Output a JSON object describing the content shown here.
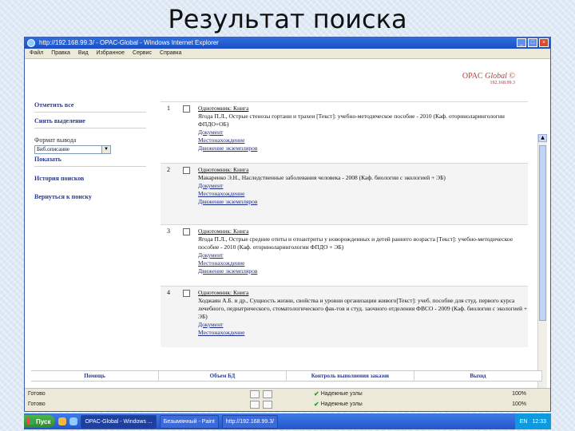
{
  "slide": {
    "title": "Результат поиска"
  },
  "window": {
    "title": "http://192.168.99.3/ - OPAC-Global - Windows Internet Explorer",
    "menu": [
      "Файл",
      "Правка",
      "Вид",
      "Избранное",
      "Сервис",
      "Справка"
    ]
  },
  "brand": {
    "name": "OPAC",
    "suffix": "Global",
    "ip": "192.168.99.3"
  },
  "sidebar": {
    "mark_all": "Отметить все",
    "unmark": "Снять выделение",
    "format_label": "Формат вывода",
    "format_value": "Биб.описание",
    "show": "Показать",
    "history": "История поисков",
    "back": "Вернуться к поиску"
  },
  "results": [
    {
      "num": "1",
      "type": "Однотомник: Книга",
      "desc": "Ягода П.Л., Острые стенозы гортани и трахеи [Текст]: учебно-методическое пособие - 2010 (Каф. оториноларингологии ФПДО+ОБ)",
      "links": [
        "Документ",
        "Местонахождение",
        "Движение экземпляров"
      ]
    },
    {
      "num": "2",
      "type": "Однотомник: Книга",
      "desc": "Макаренко Э.Н., Наследственные заболевания человека - 2008 (Каф. биологии с экологией + ЭБ)",
      "links": [
        "Документ",
        "Местонахождение",
        "Движение экземпляров"
      ]
    },
    {
      "num": "3",
      "type": "Однотомник: Книга",
      "desc": "Ягода П.Л., Острые средние отиты и отоантриты у новорожденных и детей раннего возраста [Текст]: учебно-методическое пособие - 2010 (Каф. оториноларингологии ФПДО + ЭБ)",
      "links": [
        "Документ",
        "Местонахождение",
        "Движение экземпляров"
      ]
    },
    {
      "num": "4",
      "type": "Однотомник: Книга",
      "desc": "Ходжаян А.Б. и др., Сущность жизни, свойства и уровни организации живого[Текст]: учеб. пособие для студ. первого курса лечебного, педиатрического, стоматологического фак-тов и студ. заочного отделения ФВСО - 2009 (Каф. биологии с экологией + ЭБ)",
      "links": [
        "Документ",
        "Местонахождение"
      ]
    }
  ],
  "footnav": [
    "Помощь",
    "Объем БД",
    "Контроль выполнения заказов",
    "Выход"
  ],
  "status": {
    "row1_left": "Готово",
    "row1_zone": "Надежные узлы",
    "row1_zoom": "100%",
    "row2_left": "Готово",
    "row2_zone": "Надежные узлы",
    "row2_zoom": "100%"
  },
  "taskbar": {
    "start": "Пуск",
    "tasks": [
      "OPAC-Global - Windows ...",
      "Безымянный - Paint",
      "http://192.168.99.3/"
    ],
    "lang": "EN",
    "clock": "12:33"
  }
}
